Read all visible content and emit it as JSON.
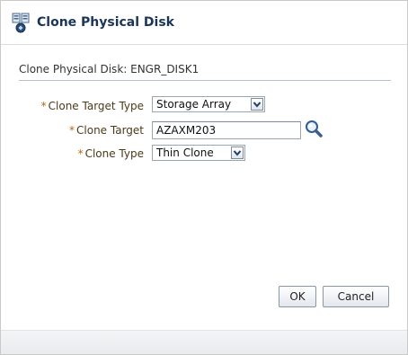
{
  "dialog": {
    "title": "Clone Physical Disk",
    "icon": "clone-disk-icon"
  },
  "subheader": {
    "text": "Clone Physical Disk: ENGR_DISK1"
  },
  "form": {
    "required_marker": "*",
    "clone_target_type": {
      "label": "Clone Target Type",
      "value": "Storage Array"
    },
    "clone_target": {
      "label": "Clone Target",
      "value": "AZAXM203",
      "search_icon": "search-icon"
    },
    "clone_type": {
      "label": "Clone Type",
      "value": "Thin Clone"
    }
  },
  "buttons": {
    "ok_label": "OK",
    "cancel_label": "Cancel"
  },
  "colors": {
    "title": "#1a3557",
    "required_asterisk": "#b5670a",
    "label": "#4b3a1a",
    "rule": "#b7c3d1"
  }
}
